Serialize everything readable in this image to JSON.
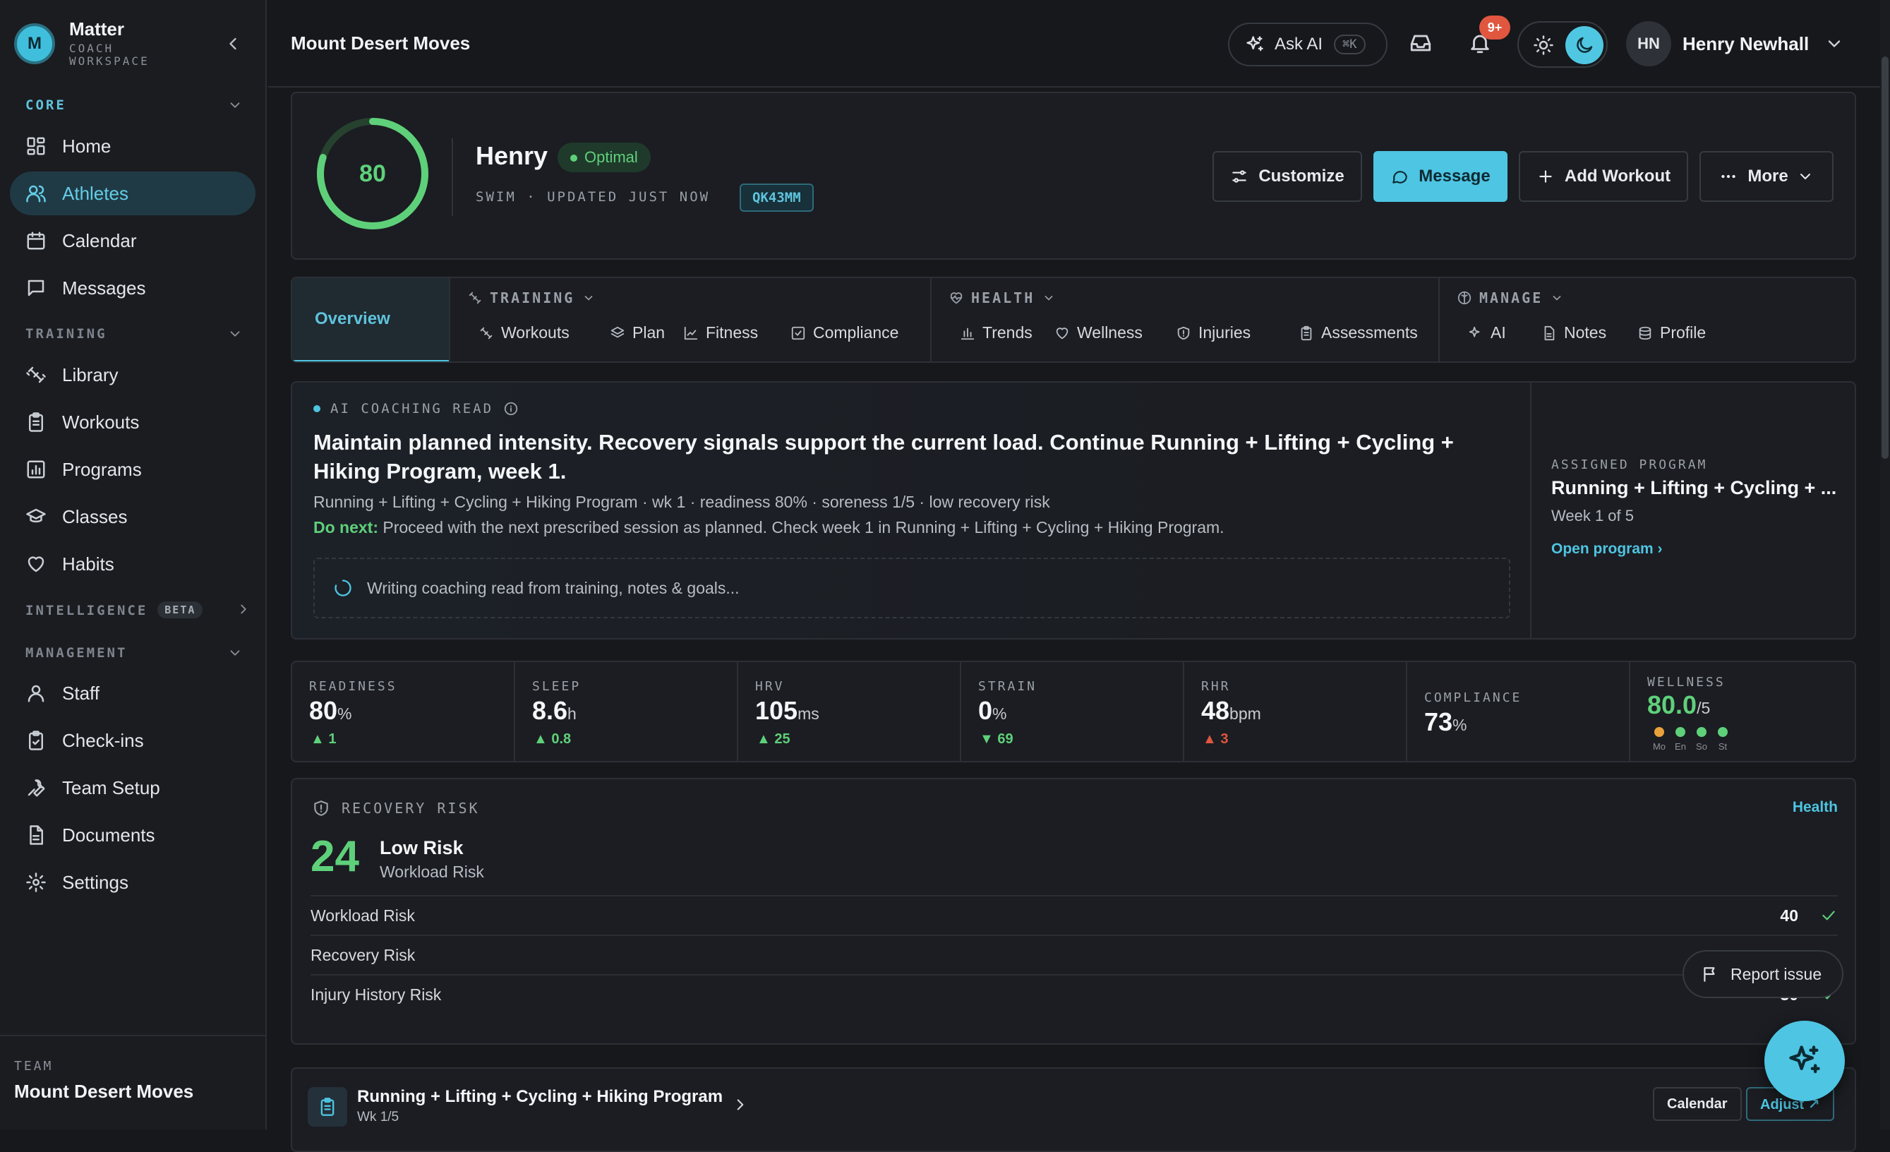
{
  "brand": {
    "logo_letter": "M",
    "name": "Matter",
    "subtitle_line1": "COACH",
    "subtitle_line2": "WORKSPACE"
  },
  "sidebar": {
    "sections": {
      "core": "CORE",
      "training": "TRAINING",
      "intelligence": "INTELLIGENCE",
      "intelligence_badge": "BETA",
      "management": "MANAGEMENT"
    },
    "core_items": [
      {
        "label": "Home",
        "icon": "grid-icon"
      },
      {
        "label": "Athletes",
        "icon": "users-icon",
        "active": true
      },
      {
        "label": "Calendar",
        "icon": "calendar-icon"
      },
      {
        "label": "Messages",
        "icon": "message-icon"
      }
    ],
    "training_items": [
      {
        "label": "Library",
        "icon": "dumbbell-icon"
      },
      {
        "label": "Workouts",
        "icon": "clipboard-icon"
      },
      {
        "label": "Programs",
        "icon": "chart-icon"
      },
      {
        "label": "Classes",
        "icon": "graduation-cap-icon"
      },
      {
        "label": "Habits",
        "icon": "heart-icon"
      }
    ],
    "management_items": [
      {
        "label": "Staff",
        "icon": "user-icon"
      },
      {
        "label": "Check-ins",
        "icon": "clipboard-check-icon"
      },
      {
        "label": "Team Setup",
        "icon": "wrench-icon"
      },
      {
        "label": "Documents",
        "icon": "document-icon"
      },
      {
        "label": "Settings",
        "icon": "gear-icon"
      }
    ],
    "team_label": "TEAM",
    "team_name": "Mount Desert Moves"
  },
  "topbar": {
    "title": "Mount Desert Moves",
    "ask_ai": "Ask AI",
    "ask_ai_shortcut": "⌘K",
    "notification_badge": "9+",
    "user_initials": "HN",
    "user_name": "Henry Newhall"
  },
  "athlete": {
    "score": 80,
    "score_max": 100,
    "name": "Henry",
    "status": "Optimal",
    "meta": "SWIM · UPDATED JUST NOW",
    "code": "QK43MM",
    "buttons": {
      "customize": "Customize",
      "message": "Message",
      "add_workout": "Add Workout",
      "more": "More"
    }
  },
  "tabs": {
    "overview": "Overview",
    "training": {
      "label": "TRAINING",
      "items": [
        "Workouts",
        "Plan",
        "Fitness",
        "Compliance"
      ]
    },
    "health": {
      "label": "HEALTH",
      "items": [
        "Trends",
        "Wellness",
        "Injuries",
        "Assessments"
      ]
    },
    "manage": {
      "label": "MANAGE",
      "items": [
        "AI",
        "Notes",
        "Profile"
      ]
    }
  },
  "coaching": {
    "label": "AI COACHING READ",
    "title": "Maintain planned intensity. Recovery signals support the current load. Continue Running + Lifting + Cycling + Hiking Program, week 1.",
    "summary": "Running + Lifting + Cycling + Hiking Program · wk 1 · readiness 80% · soreness 1/5 · low recovery risk",
    "do_next_label": "Do next:",
    "do_next": "Proceed with the next prescribed session as planned. Check week 1 in Running + Lifting + Cycling + Hiking Program.",
    "loading": "Writing coaching read from training, notes & goals...",
    "program_label": "ASSIGNED PROGRAM",
    "program_name": "Running + Lifting + Cycling + ...",
    "program_week": "Week 1 of 5",
    "program_link": "Open program ›"
  },
  "metrics": [
    {
      "label": "READINESS",
      "value": "80",
      "unit": "%",
      "delta": "▲ 1",
      "tone": "up"
    },
    {
      "label": "SLEEP",
      "value": "8.6",
      "unit": "h",
      "delta": "▲ 0.8",
      "tone": "up"
    },
    {
      "label": "HRV",
      "value": "105",
      "unit": "ms",
      "delta": "▲ 25",
      "tone": "up"
    },
    {
      "label": "STRAIN",
      "value": "0",
      "unit": "%",
      "delta": "▼ 69",
      "tone": "down"
    },
    {
      "label": "RHR",
      "value": "48",
      "unit": "bpm",
      "delta": "▲ 3",
      "tone": "up-red"
    },
    {
      "label": "COMPLIANCE",
      "value": "73",
      "unit": "%",
      "delta": "",
      "tone": ""
    },
    {
      "label": "WELLNESS",
      "value": "80.0",
      "unit": "/5",
      "delta": "",
      "tone": "",
      "dots": [
        {
          "day": "Mo",
          "color": "amber"
        },
        {
          "day": "En",
          "color": "green"
        },
        {
          "day": "So",
          "color": "green"
        },
        {
          "day": "St",
          "color": "green"
        }
      ]
    }
  ],
  "risk": {
    "label": "RECOVERY RISK",
    "link": "Health",
    "score": "24",
    "title": "Low Risk",
    "subtitle": "Workload Risk",
    "rows": [
      {
        "label": "Workload Risk",
        "value": "40"
      },
      {
        "label": "Recovery Risk",
        "value": ""
      },
      {
        "label": "Injury History Risk",
        "value": "30"
      }
    ],
    "report": "Report issue"
  },
  "program_row": {
    "name": "Running + Lifting + Cycling + Hiking Program",
    "week": "Wk 1/5",
    "calendar": "Calendar",
    "adjust": "Adjust ↗"
  }
}
